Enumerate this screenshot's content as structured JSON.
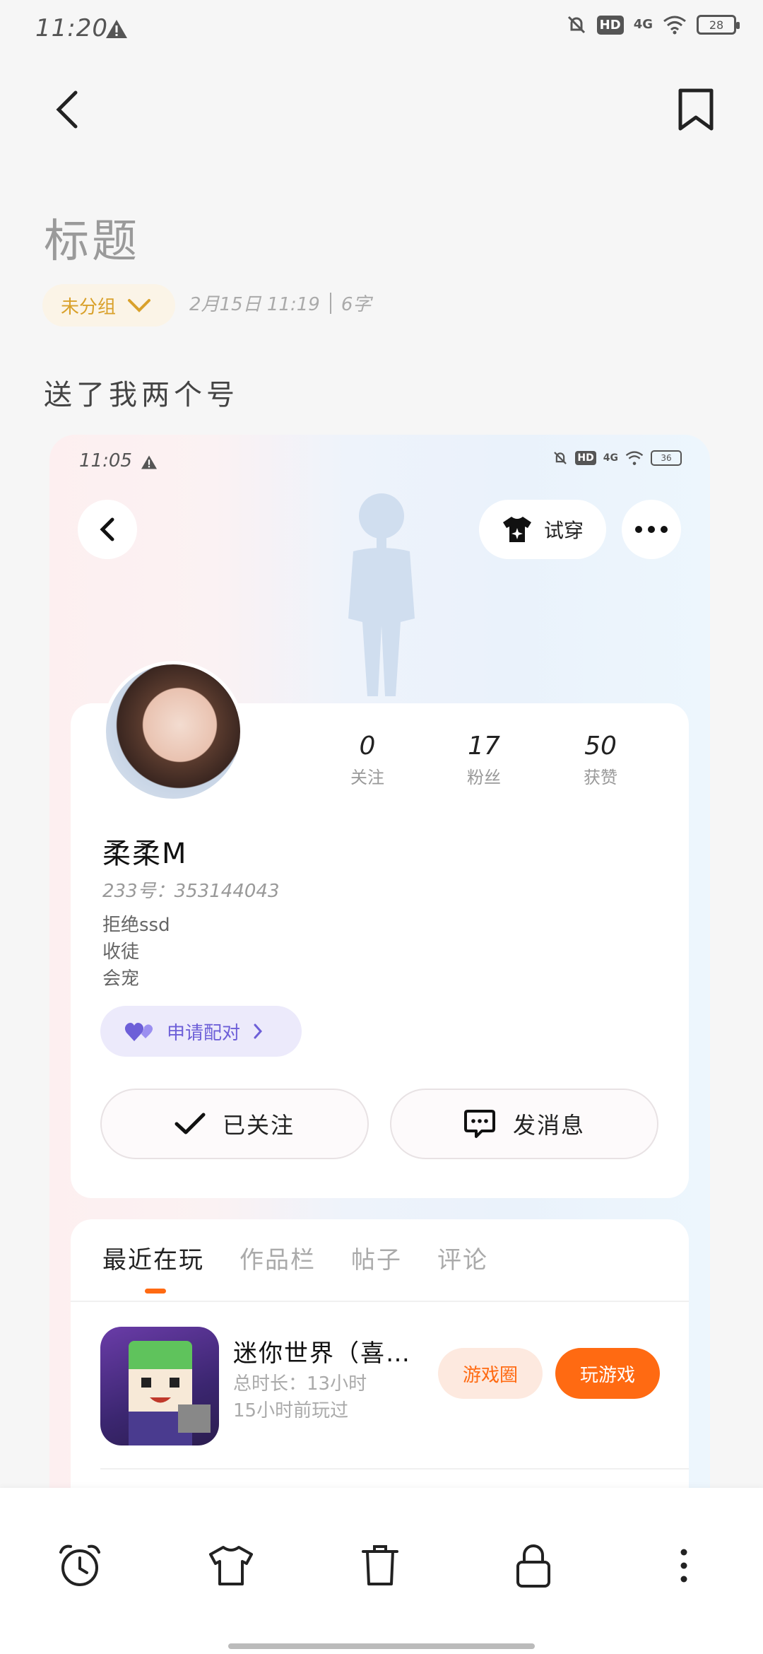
{
  "status_bar": {
    "time": "11:20",
    "battery": "28",
    "network": "4G",
    "hd": "HD"
  },
  "note": {
    "title": "标题",
    "group": "未分组",
    "date": "2月15日 11:19",
    "word_count": "6字",
    "body": "送了我两个号"
  },
  "screenshot": {
    "status_bar": {
      "time": "11:05",
      "battery": "36",
      "network": "4G",
      "hd": "HD"
    },
    "try_on_label": "试穿",
    "profile": {
      "stats": [
        {
          "value": "0",
          "label": "关注"
        },
        {
          "value": "17",
          "label": "粉丝"
        },
        {
          "value": "50",
          "label": "获赞"
        }
      ],
      "nickname": "柔柔M",
      "id_line": "233号：353144043",
      "bio": [
        "拒绝ssd",
        "收徒",
        "会宠"
      ],
      "pair_label": "申请配对",
      "follow_label": "已关注",
      "message_label": "发消息"
    },
    "tabs": [
      "最近在玩",
      "作品栏",
      "帖子",
      "评论"
    ],
    "active_tab": "最近在玩",
    "game": {
      "name": "迷你世界（喜…",
      "total_time": "总时长：13小时",
      "last_played": "15小时前玩过",
      "circle_label": "游戏圈",
      "play_label": "玩游戏"
    },
    "colors": {
      "accent": "#ff6a12",
      "pair": "#6d5fd8"
    }
  },
  "toolbar": {
    "icons": [
      "alarm-icon",
      "shirt-icon",
      "trash-icon",
      "lock-icon",
      "more-vertical-icon"
    ]
  }
}
